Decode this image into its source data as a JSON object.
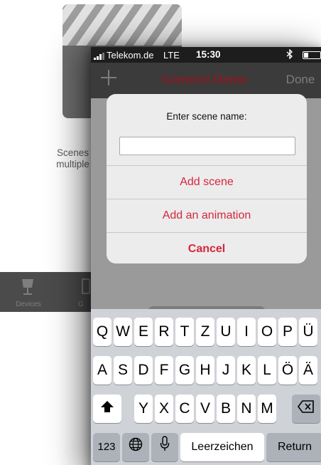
{
  "background": {
    "hint_line1": "Scenes m",
    "hint_line2": "multiple lu",
    "tab_devices": "Devices",
    "tab_partial": "G"
  },
  "status_bar": {
    "carrier": "Telekom.de",
    "network": "LTE",
    "time": "15:30"
  },
  "nav_bar": {
    "title": "Connect Demo",
    "done_label": "Done"
  },
  "alert": {
    "title": "Enter scene name:",
    "input_value": "",
    "actions": [
      "Add scene",
      "Add an animation",
      "Cancel"
    ]
  },
  "keyboard": {
    "row1": [
      "Q",
      "W",
      "E",
      "R",
      "T",
      "Z",
      "U",
      "I",
      "O",
      "P",
      "Ü"
    ],
    "row2": [
      "A",
      "S",
      "D",
      "F",
      "G",
      "H",
      "J",
      "K",
      "L",
      "Ö",
      "Ä"
    ],
    "row3": [
      "Y",
      "X",
      "C",
      "V",
      "B",
      "N",
      "M"
    ],
    "numbers_label": "123",
    "space_label": "Leerzeichen",
    "return_label": "Return"
  },
  "colors": {
    "accent_red": "#d6263d",
    "title_red_dimmed": "#8a1a24",
    "keyboard_bg": "#cfd2d7"
  }
}
